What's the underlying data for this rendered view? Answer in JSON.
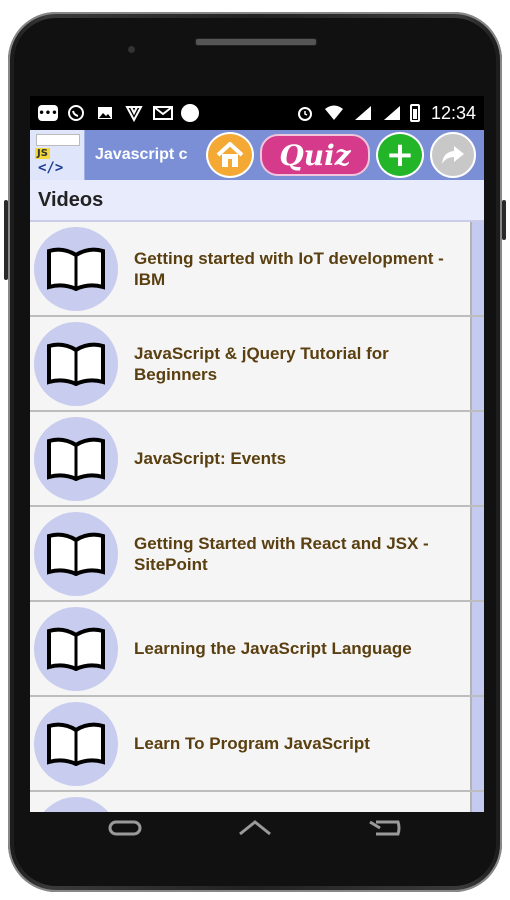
{
  "status_bar": {
    "time": "12:34",
    "icons": [
      "message-icon",
      "whatsapp-icon",
      "image-icon",
      "shield-icon",
      "gmail-icon",
      "circle-icon",
      "alarm-icon",
      "wifi-icon",
      "signal-icon",
      "signal-icon",
      "battery-icon"
    ]
  },
  "app_bar": {
    "title": "Javascript c",
    "quiz_label": "Quiz",
    "home": "home-icon",
    "add": "plus-icon",
    "share": "share-icon"
  },
  "section": {
    "title": "Videos"
  },
  "videos": [
    {
      "label": "Getting started with IoT development - IBM"
    },
    {
      "label": "JavaScript & jQuery Tutorial for Beginners"
    },
    {
      "label": "JavaScript: Events"
    },
    {
      "label": "Getting Started with React and JSX - SitePoint"
    },
    {
      "label": "Learning the JavaScript Language"
    },
    {
      "label": "Learn To Program JavaScript"
    }
  ],
  "colors": {
    "app_bar": "#7b8fd6",
    "item_text": "#5a3f10",
    "icon_bg": "#c8ccef",
    "quiz": "#d63a8a",
    "home": "#f3a934",
    "add": "#22b528"
  }
}
